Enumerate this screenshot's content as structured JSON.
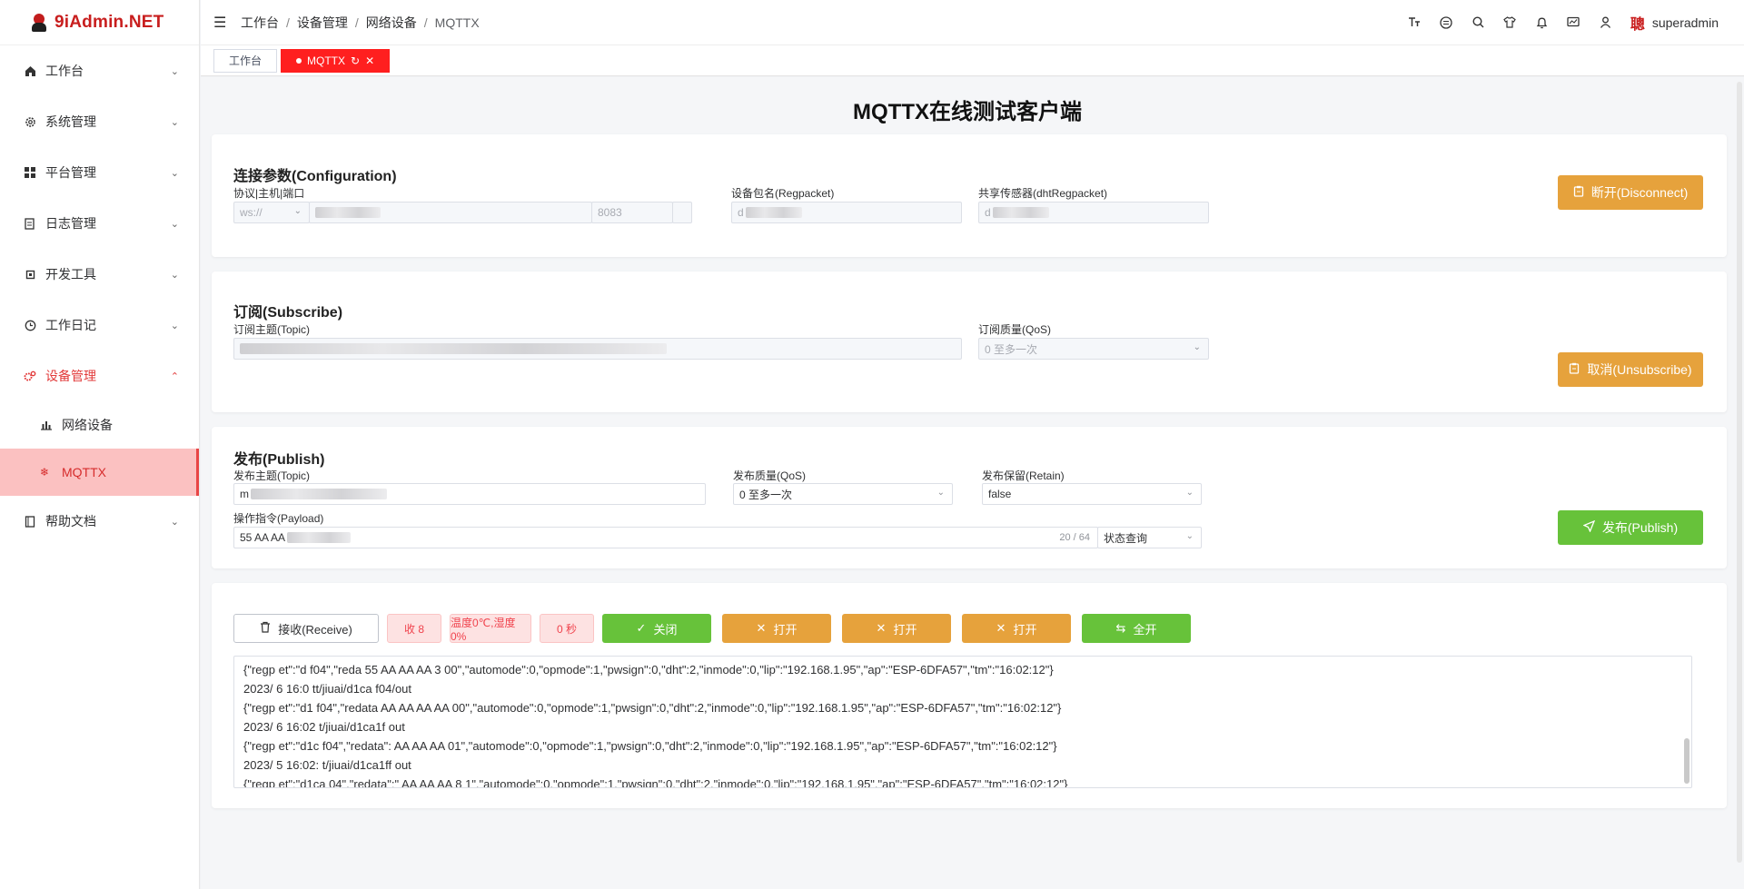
{
  "app": {
    "logo": "9iAdmin.NET"
  },
  "sidebar": {
    "items": [
      {
        "label": "工作台"
      },
      {
        "label": "系统管理"
      },
      {
        "label": "平台管理"
      },
      {
        "label": "日志管理"
      },
      {
        "label": "开发工具"
      },
      {
        "label": "工作日记"
      },
      {
        "label": "设备管理"
      },
      {
        "label": "帮助文档"
      }
    ],
    "sub_items": [
      {
        "label": "网络设备"
      },
      {
        "label": "MQTTX"
      }
    ]
  },
  "breadcrumb": [
    "工作台",
    "设备管理",
    "网络设备",
    "MQTTX"
  ],
  "header": {
    "avatar_char": "聰",
    "username": "superadmin"
  },
  "tabs": [
    {
      "label": "工作台"
    },
    {
      "label": "MQTTX"
    }
  ],
  "page": {
    "title": "MQTTX在线测试客户端"
  },
  "config": {
    "title": "连接参数(Configuration)",
    "protocol_label": "协议|主机|端口",
    "protocol_value": "ws://",
    "port_value": "8083",
    "regpacket_label": "设备包名(Regpacket)",
    "regpacket_prefix": "d",
    "dht_label": "共享传感器(dhtRegpacket)",
    "dht_prefix": "d",
    "button": "断开(Disconnect)"
  },
  "subscribe": {
    "title": "订阅(Subscribe)",
    "topic_label": "订阅主题(Topic)",
    "qos_label": "订阅质量(QoS)",
    "qos_value": "0 至多一次",
    "button": "取消(Unsubscribe)"
  },
  "publish": {
    "title": "发布(Publish)",
    "topic_label": "发布主题(Topic)",
    "topic_prefix": "m",
    "qos_label": "发布质量(QoS)",
    "qos_value": "0 至多一次",
    "retain_label": "发布保留(Retain)",
    "retain_value": "false",
    "payload_label": "操作指令(Payload)",
    "payload_value": "55 AA AA",
    "payload_count": "20 / 64",
    "command_value": "状态查询",
    "button": "发布(Publish)"
  },
  "receive": {
    "button": "接收(Receive)",
    "count": "收 8",
    "sensor": "温度0℃,湿度0%",
    "seconds": "0 秒",
    "close": "关闭",
    "open1": "打开",
    "open2": "打开",
    "open3": "打开",
    "all_on": "全开",
    "log_lines": [
      "{\"regp        et\":\"d       f04\",\"reda         55 AA AA AA        3 00\",\"automode\":0,\"opmode\":1,\"pwsign\":0,\"dht\":2,\"inmode\":0,\"lip\":\"192.168.1.95\",\"ap\":\"ESP-6DFA57\",\"tm\":\"16:02:12\"}",
      "2023/     6 16:0             tt/jiuai/d1ca        f04/out",
      "{\"regp        et\":\"d1         f04\",\"redata        AA AA AA AA          00\",\"automode\":0,\"opmode\":1,\"pwsign\":0,\"dht\":2,\"inmode\":0,\"lip\":\"192.168.1.95\",\"ap\":\"ESP-6DFA57\",\"tm\":\"16:02:12\"}",
      "2023/     6 16:02           t/jiuai/d1ca1f           out",
      "{\"regp        et\":\"d1c         f04\",\"redata\":        AA AA AA          01\",\"automode\":0,\"opmode\":1,\"pwsign\":0,\"dht\":2,\"inmode\":0,\"lip\":\"192.168.1.95\",\"ap\":\"ESP-6DFA57\",\"tm\":\"16:02:12\"}",
      "2023/     5 16:02:          t/jiuai/d1ca1ff          out",
      "{\"regp        et\":\"d1ca        04\",\"redata\":\"        AA AA AA 8           1\",\"automode\":0,\"opmode\":1,\"pwsign\":0,\"dht\":2,\"inmode\":0,\"lip\":\"192.168.1.95\",\"ap\":\"ESP-6DFA57\",\"tm\":\"16:02:12\"}"
    ]
  },
  "colors": {
    "brand": "#c81e1e",
    "tab_active": "#ff1f1f",
    "menu_active": "#e23a3a",
    "selected_bg": "#fbc1c1",
    "warning": "#e6a23c",
    "success": "#67c23a"
  }
}
